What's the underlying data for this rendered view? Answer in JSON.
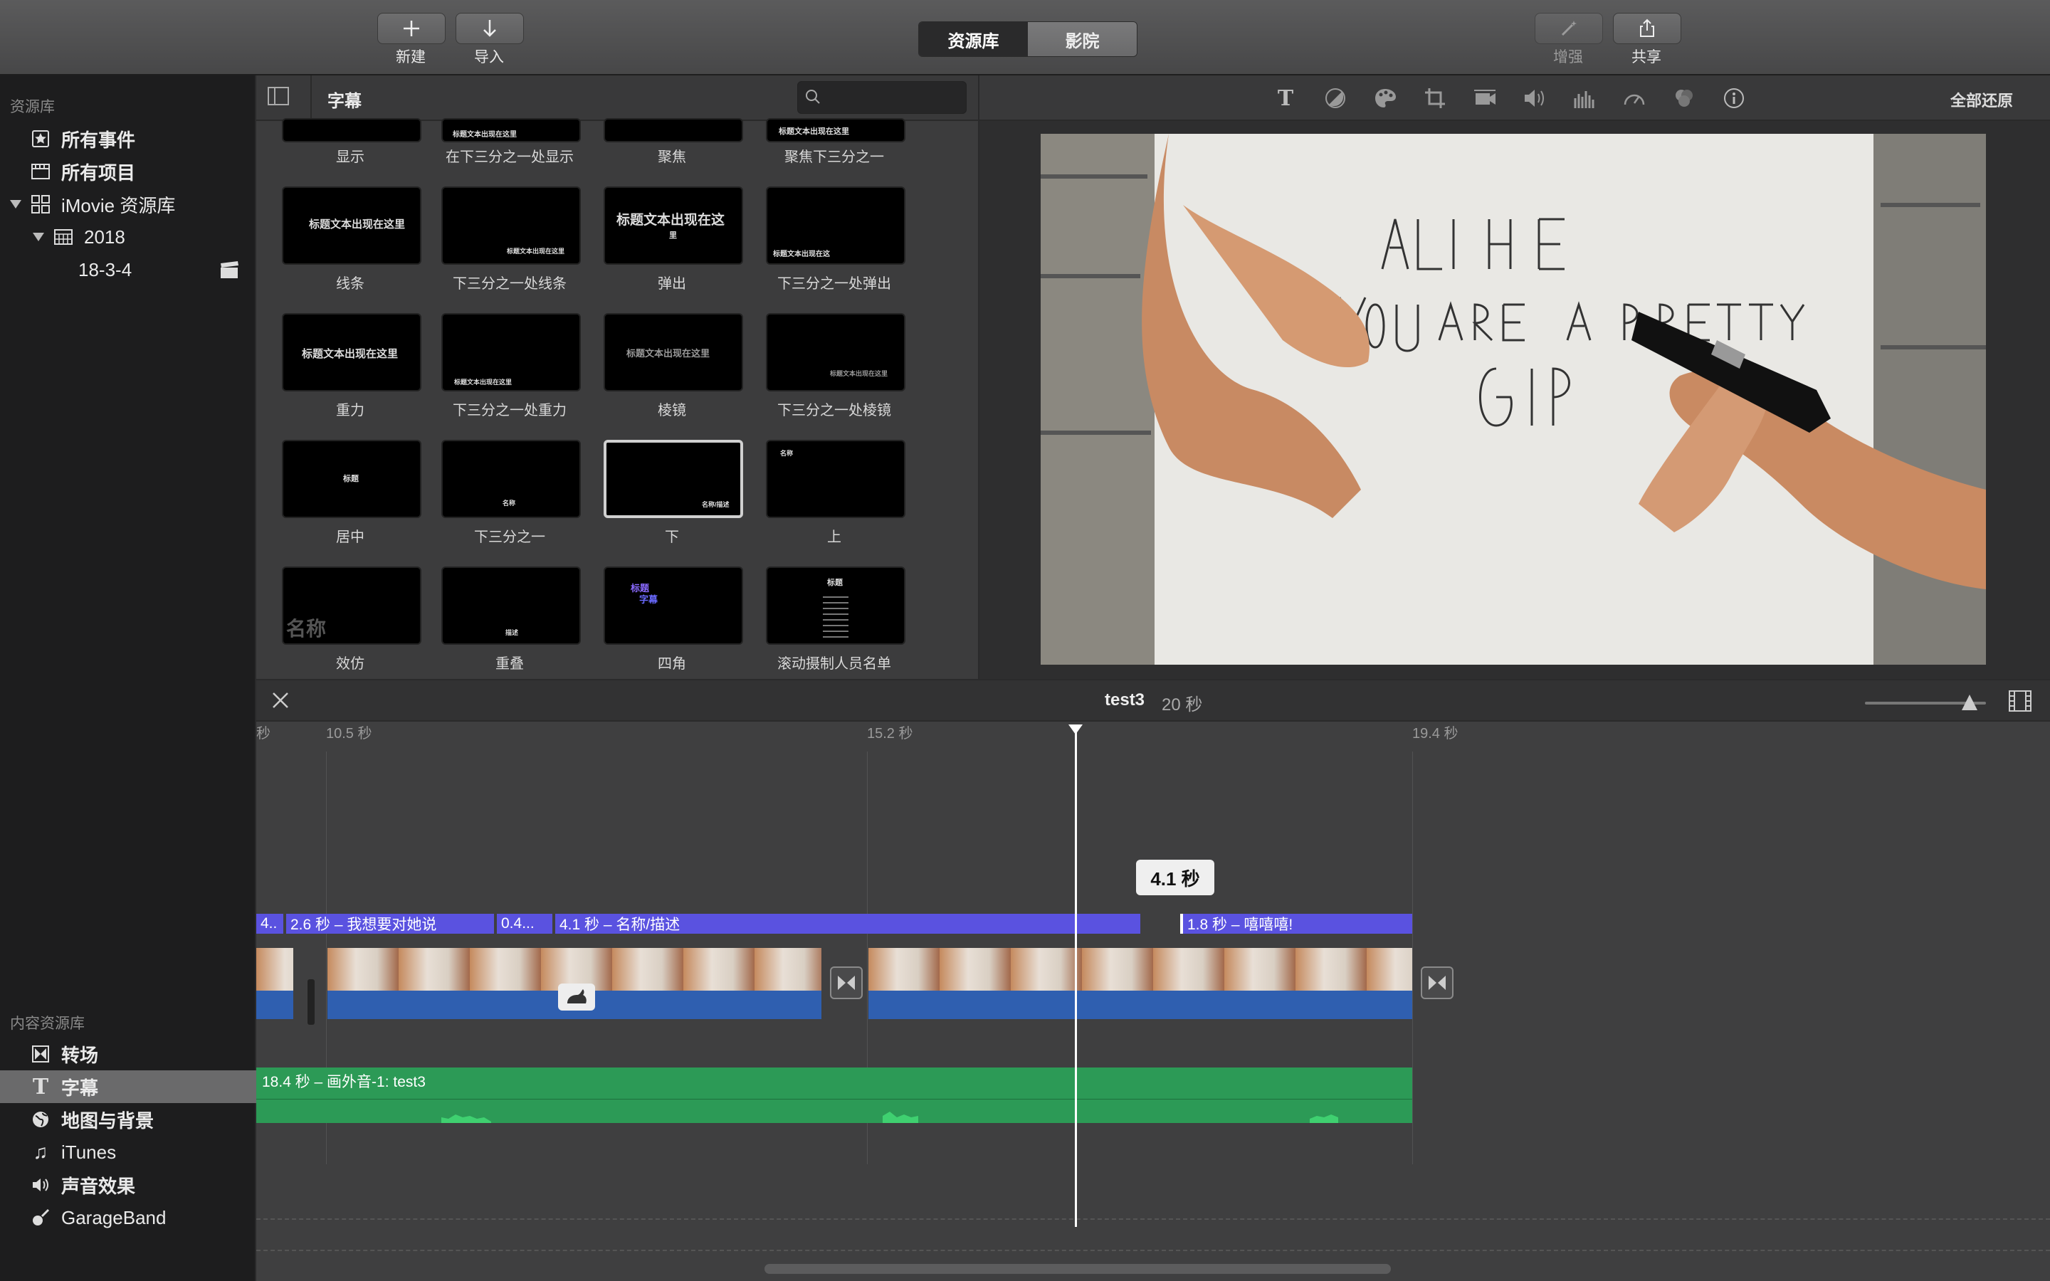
{
  "toolbar": {
    "new_label": "新建",
    "import_label": "导入",
    "enhance_label": "增强",
    "share_label": "共享",
    "segment": [
      "资源库",
      "影院"
    ]
  },
  "sidebar": {
    "library_header": "资源库",
    "items": [
      "所有事件",
      "所有项目",
      "iMovie 资源库",
      "2018",
      "18-3-4"
    ],
    "content_header": "内容资源库",
    "content_items": [
      "转场",
      "字幕",
      "地图与背景",
      "iTunes",
      "声音效果",
      "GarageBand"
    ]
  },
  "browser": {
    "title": "字幕",
    "search_value": "",
    "captions": [
      "显示",
      "在下三分之一处显示",
      "聚焦",
      "聚焦下三分之一",
      "线条",
      "下三分之一处线条",
      "弹出",
      "下三分之一处弹出",
      "重力",
      "下三分之一处重力",
      "棱镜",
      "下三分之一处棱镜",
      "居中",
      "下三分之一",
      "下",
      "上",
      "效仿",
      "重叠",
      "四角",
      "滚动摄制人员名单"
    ],
    "tile_text": {
      "t0": "标题文本出现在这里",
      "line": "标题文本出现在这里",
      "popup": "标题文本出现在这",
      "popup2": "里",
      "gravity": "标题文本出现在这里",
      "prism": "标题文本出现在这里",
      "center_title": "标题",
      "bottom_name": "名称/描述",
      "top_name": "名称",
      "echo": "名称",
      "overlap": "描述",
      "corner_title": "标题",
      "corner_sub": "字幕",
      "credits_title": "标题"
    }
  },
  "viewer": {
    "reset_label": "全部还原"
  },
  "timeline": {
    "project_name": "test3",
    "duration": "20 秒",
    "ruler": [
      "秒",
      "10.5 秒",
      "15.2 秒",
      "19.4 秒"
    ],
    "title_bars": [
      "4..",
      "2.6 秒 – 我想要对她说",
      "0.4...",
      "4.1 秒 – 名称/描述",
      "1.8 秒 – 嘻嘻嘻!"
    ],
    "tooltip": "4.1 秒",
    "audio_label": "18.4 秒 – 画外音-1: test3"
  }
}
